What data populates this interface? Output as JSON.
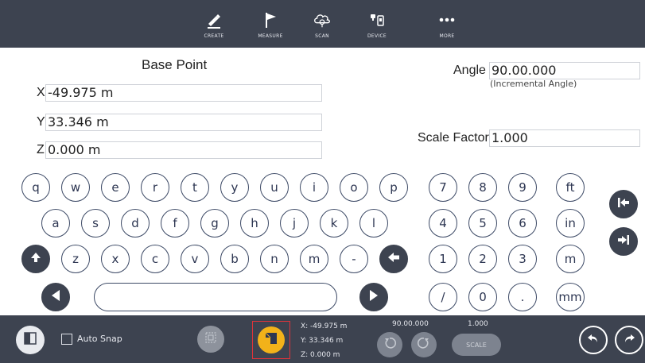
{
  "toolbar": {
    "items": [
      {
        "label": "CREATE",
        "icon": "pencil-icon"
      },
      {
        "label": "MEASURE",
        "icon": "flag-icon"
      },
      {
        "label": "SCAN",
        "icon": "scan-cloud-icon"
      },
      {
        "label": "DEVICE",
        "icon": "device-icon"
      },
      {
        "label": "MORE",
        "icon": "more-dots-icon"
      }
    ]
  },
  "form": {
    "title": "Base Point",
    "x_label": "X",
    "x_value": "-49.975 m",
    "y_label": "Y",
    "y_value": "33.346 m",
    "z_label": "Z",
    "z_value": "0.000 m",
    "angle_label": "Angle",
    "angle_value": "90.00.000",
    "angle_note": "(Incremental Angle)",
    "scale_label": "Scale Factor",
    "scale_value": "1.000"
  },
  "keyboard": {
    "row1": [
      "q",
      "w",
      "e",
      "r",
      "t",
      "y",
      "u",
      "i",
      "o",
      "p"
    ],
    "row2": [
      "a",
      "s",
      "d",
      "f",
      "g",
      "h",
      "j",
      "k",
      "l"
    ],
    "row3": [
      "z",
      "x",
      "c",
      "v",
      "b",
      "n",
      "m",
      "-"
    ],
    "numpad": [
      "7",
      "8",
      "9",
      "ft",
      "4",
      "5",
      "6",
      "in",
      "1",
      "2",
      "3",
      "m",
      "/",
      "0",
      ".",
      "mm"
    ]
  },
  "bottom": {
    "auto_snap_label": "Auto Snap",
    "coord_x": "X: -49.975 m",
    "coord_y": "Y: 33.346 m",
    "coord_z": "Z: 0.000 m",
    "angle_value": "90.00.000",
    "scale_value": "1.000",
    "scale_button": "SCALE"
  },
  "colors": {
    "toolbar_bg": "#3d4350",
    "key_border": "#3d4a66",
    "highlight_border": "#e0343a",
    "capture_icon": "#f2b21a"
  }
}
